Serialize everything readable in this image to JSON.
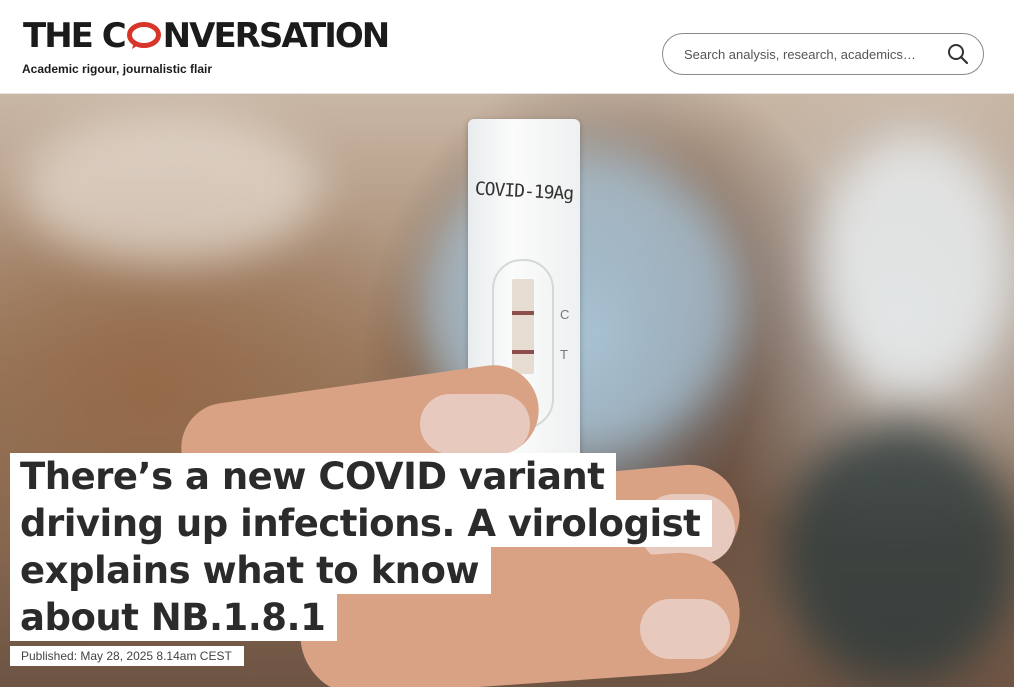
{
  "brand": {
    "logo_left": "THE C",
    "logo_right": "NVERSATION",
    "tagline": "Academic rigour, journalistic flair",
    "accent_color": "#d8352a"
  },
  "search": {
    "placeholder": "Search analysis, research, academics…",
    "icon": "search-icon"
  },
  "hero": {
    "image_subject": "rapid-antigen-test-held-in-hand",
    "test_card_label": "COVID-19Ag",
    "marker_c": "C",
    "marker_t": "T"
  },
  "article": {
    "headline_lines": [
      "There’s a new COVID variant",
      "driving up infections. A virologist",
      "explains what to know",
      "about NB.1.8.1"
    ],
    "published": "Published: May 28, 2025 8.14am CEST"
  }
}
